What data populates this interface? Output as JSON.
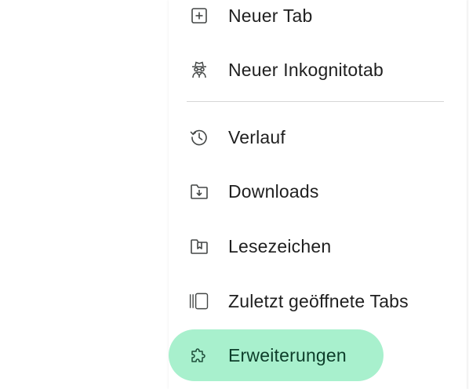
{
  "menu": {
    "items": [
      {
        "label": "Neuer Tab",
        "icon": "plus-box-icon"
      },
      {
        "label": "Neuer Inkognitotab",
        "icon": "incognito-icon"
      },
      {
        "label": "Verlauf",
        "icon": "history-icon"
      },
      {
        "label": "Downloads",
        "icon": "download-folder-icon"
      },
      {
        "label": "Lesezeichen",
        "icon": "bookmark-folder-icon"
      },
      {
        "label": "Zuletzt geöffnete Tabs",
        "icon": "recent-tabs-icon"
      },
      {
        "label": "Erweiterungen",
        "icon": "puzzle-icon",
        "highlighted": true
      }
    ]
  },
  "colors": {
    "highlight": "#a8f0cd",
    "text": "#1f1f1f",
    "icon": "#444746",
    "divider": "#d6d6d6"
  }
}
